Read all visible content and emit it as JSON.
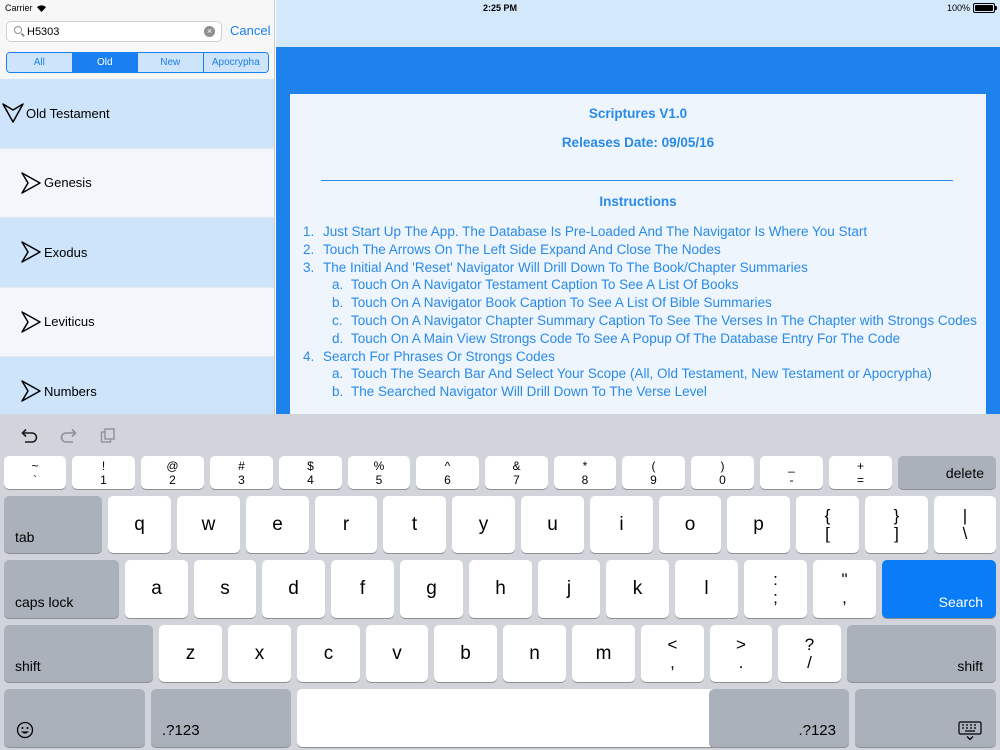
{
  "status": {
    "carrier": "Carrier",
    "time": "2:25 PM",
    "battery": "100%"
  },
  "search": {
    "value": "H5303",
    "cancel_label": "Cancel"
  },
  "scope": {
    "options": [
      "All",
      "Old",
      "New",
      "Apocrypha"
    ],
    "selected": "Old"
  },
  "navigator": {
    "items": [
      {
        "label": "Old Testament",
        "expanded": true
      },
      {
        "label": "Genesis",
        "expanded": false
      },
      {
        "label": "Exodus",
        "expanded": false
      },
      {
        "label": "Leviticus",
        "expanded": false
      },
      {
        "label": "Numbers",
        "expanded": false
      }
    ]
  },
  "main": {
    "title": "Scriptures V1.0",
    "release": "Releases Date: 09/05/16",
    "instructions_heading": "Instructions",
    "items": [
      {
        "marker": "1.",
        "text": "Just Start Up The App. The Database Is Pre-Loaded And The Navigator Is Where You Start"
      },
      {
        "marker": "2.",
        "text": "Touch The Arrows On The Left Side Expand And Close The Nodes"
      },
      {
        "marker": "3.",
        "text": "The Initial And 'Reset' Navigator Will Drill Down To The Book/Chapter Summaries"
      },
      {
        "marker": "a.",
        "text": "Touch On A Navigator Testament Caption To See A List Of Books"
      },
      {
        "marker": "b.",
        "text": "Touch On A Navigator Book Caption To See A List Of Bible Summaries"
      },
      {
        "marker": "c.",
        "text": "Touch On A Navigator Chapter Summary Caption To See The Verses In The Chapter with Strongs Codes"
      },
      {
        "marker": "d.",
        "text": "Touch On A Main View Strongs Code To See A Popup Of The Database Entry For The Code"
      },
      {
        "marker": "4.",
        "text": "Search For Phrases Or Strongs Codes"
      },
      {
        "marker": "a.",
        "text": "Touch The Search Bar And Select Your Scope (All, Old Testament, New Testament or Apocrypha)"
      },
      {
        "marker": "b.",
        "text": "The Searched Navigator Will Drill Down To The Verse Level"
      }
    ]
  },
  "keyboard": {
    "number_row": [
      [
        "~",
        "`"
      ],
      [
        "!",
        "1"
      ],
      [
        "@",
        "2"
      ],
      [
        "#",
        "3"
      ],
      [
        "$",
        "4"
      ],
      [
        "%",
        "5"
      ],
      [
        "^",
        "6"
      ],
      [
        "&",
        "7"
      ],
      [
        "*",
        "8"
      ],
      [
        "(",
        "9"
      ],
      [
        ")",
        "0"
      ],
      [
        "_",
        "-"
      ],
      [
        "+",
        "="
      ]
    ],
    "delete": "delete",
    "tab": "tab",
    "row1": [
      "q",
      "w",
      "e",
      "r",
      "t",
      "y",
      "u",
      "i",
      "o",
      "p"
    ],
    "row1_sym": [
      [
        "{",
        "["
      ],
      [
        "}",
        "]"
      ],
      [
        "|",
        "\\"
      ]
    ],
    "caps": "caps lock",
    "row2": [
      "a",
      "s",
      "d",
      "f",
      "g",
      "h",
      "j",
      "k",
      "l"
    ],
    "row2_sym": [
      [
        ":",
        ";"
      ],
      [
        "\"",
        ","
      ]
    ],
    "search": "Search",
    "shift": "shift",
    "row3": [
      "z",
      "x",
      "c",
      "v",
      "b",
      "n",
      "m"
    ],
    "row3_sym": [
      [
        "<",
        ","
      ],
      [
        ">",
        "."
      ],
      [
        "?",
        "/"
      ]
    ],
    "numbers_label": ".?123",
    "icons": [
      "undo-icon",
      "redo-icon",
      "paste-icon",
      "emoji-icon",
      "keyboard-dismiss-icon"
    ]
  }
}
